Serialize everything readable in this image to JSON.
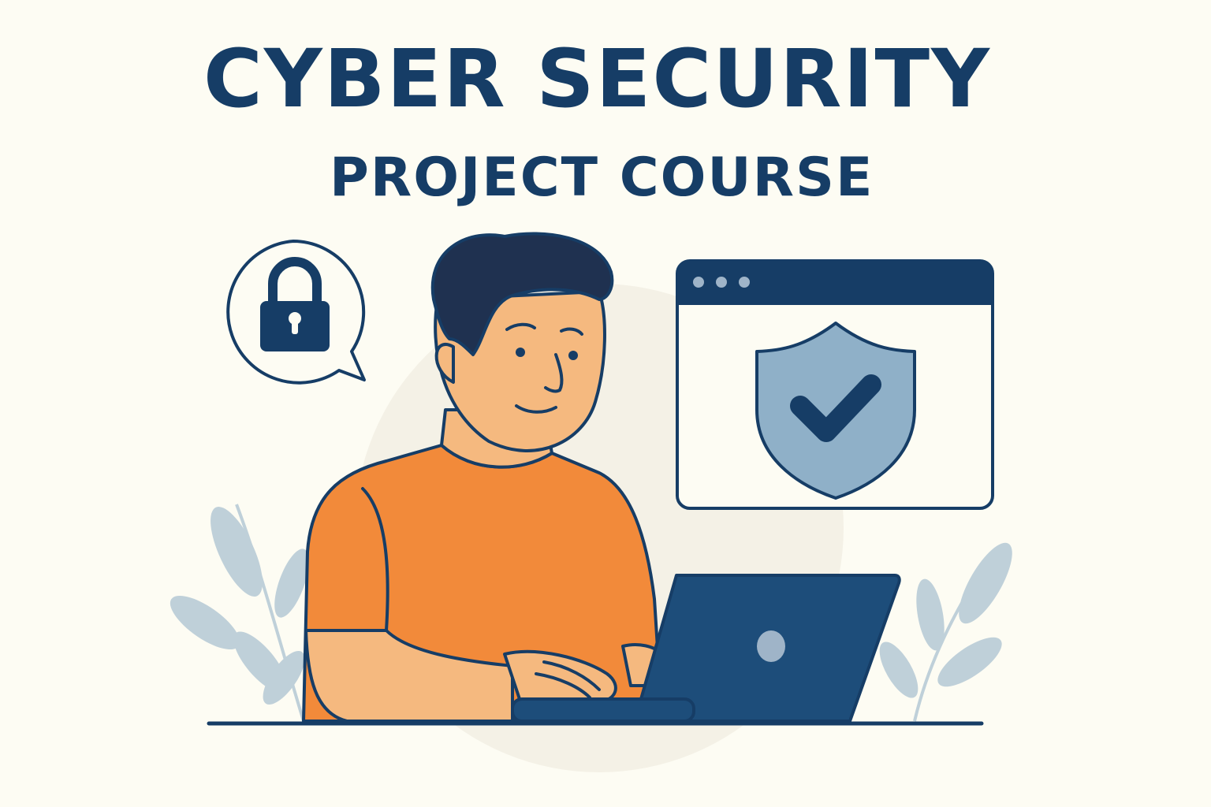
{
  "header": {
    "title": "CYBER SECURITY",
    "subtitle": "PROJECT COURSE"
  },
  "illustration": {
    "icons": [
      "lock-icon",
      "speech-bubble",
      "browser-window",
      "shield-check-icon",
      "laptop",
      "plant-leaves"
    ]
  },
  "colors": {
    "background": "#fdfcf3",
    "navy": "#163d66",
    "shirt_orange": "#f28a3a",
    "skin": "#f5b97f",
    "shield_blue": "#8fb0c8",
    "leaf": "#b9ccd6"
  }
}
